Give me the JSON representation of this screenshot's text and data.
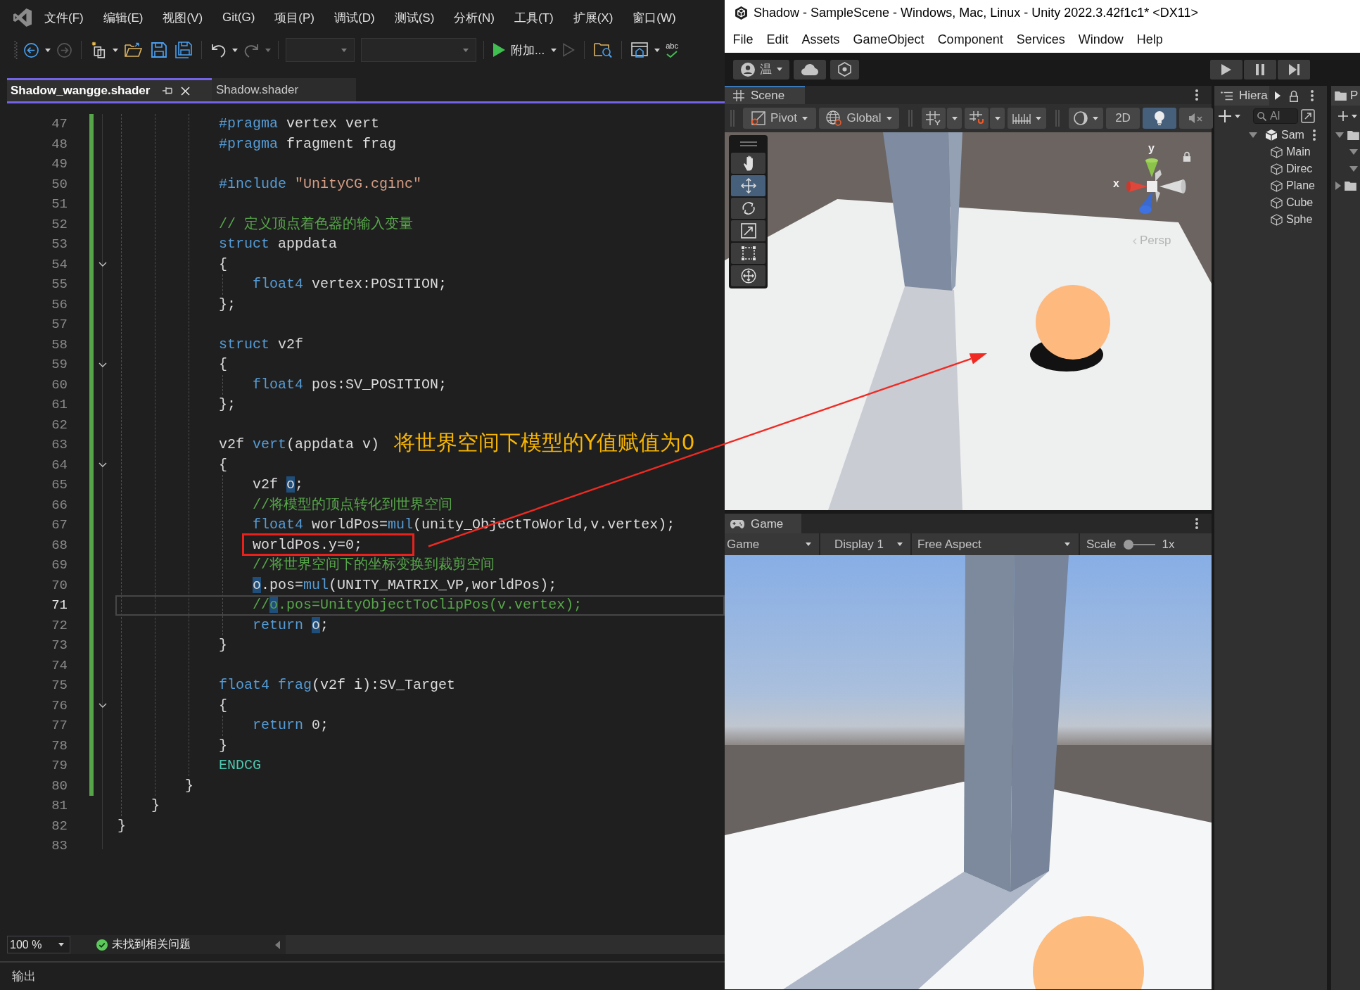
{
  "editor": {
    "menu": [
      "文件(F)",
      "编辑(E)",
      "视图(V)",
      "Git(G)",
      "项目(P)",
      "调试(D)",
      "测试(S)",
      "分析(N)",
      "工具(T)",
      "扩展(X)",
      "窗口(W)"
    ],
    "toolbar": [
      [
        {
          "kind": "back",
          "disabled": false,
          "dropdown": true
        },
        {
          "kind": "forward",
          "disabled": true
        }
      ],
      [
        {
          "kind": "new_project",
          "disabled": false,
          "dropdown": true
        },
        {
          "kind": "open",
          "disabled": false
        },
        {
          "kind": "save",
          "disabled": false
        },
        {
          "kind": "save_all",
          "disabled": false
        }
      ],
      [
        {
          "kind": "undo",
          "disabled": false,
          "dropdown": true
        },
        {
          "kind": "redo",
          "disabled": true,
          "dropdown": true
        }
      ],
      [
        {
          "kind": "config_combo",
          "disabled": true,
          "dropdown": true
        },
        {
          "kind": "platform_combo",
          "disabled": true,
          "dropdown": true
        }
      ],
      [
        {
          "kind": "start",
          "label": "附加...",
          "disabled": false,
          "dropdown": true
        },
        {
          "kind": "start_no_debug",
          "disabled": true
        }
      ],
      [
        {
          "kind": "find_in_files",
          "disabled": false
        }
      ],
      [
        {
          "kind": "layout",
          "disabled": false,
          "dropdown": true
        },
        {
          "kind": "spellcheck",
          "label": "abc",
          "disabled": false
        }
      ]
    ],
    "tabs": [
      {
        "label": "Shadow_wangge.shader",
        "selected": true
      },
      {
        "label": "Shadow.shader",
        "selected": false
      }
    ],
    "lines": [
      {
        "number": "47",
        "changed": true,
        "current": false,
        "tokens": [
          {
            "kind": "keyword",
            "text": "            #pragma"
          },
          {
            "kind": "plain",
            "text": " vertex vert"
          }
        ]
      },
      {
        "number": "48",
        "changed": true,
        "current": false,
        "tokens": [
          {
            "kind": "keyword",
            "text": "            #pragma"
          },
          {
            "kind": "plain",
            "text": " fragment frag"
          }
        ]
      },
      {
        "number": "49",
        "changed": true,
        "current": false
      },
      {
        "number": "50",
        "changed": true,
        "current": false,
        "tokens": [
          {
            "kind": "keyword",
            "text": "            #include"
          },
          {
            "kind": "string",
            "text": " \"UnityCG.cginc\""
          }
        ]
      },
      {
        "number": "51",
        "changed": true,
        "current": false
      },
      {
        "number": "52",
        "changed": true,
        "current": false,
        "tokens": [
          {
            "kind": "comment",
            "text": "            // 定义顶点着色器的输入变量"
          }
        ]
      },
      {
        "number": "53",
        "changed": true,
        "current": false,
        "tokens": [
          {
            "kind": "keyword",
            "text": "            struct"
          },
          {
            "kind": "plain",
            "text": " appdata"
          }
        ]
      },
      {
        "number": "54",
        "changed": true,
        "current": false,
        "fold": true,
        "tokens": [
          {
            "kind": "plain",
            "text": "            {"
          }
        ]
      },
      {
        "number": "55",
        "changed": true,
        "current": false,
        "tokens": [
          {
            "kind": "keyword",
            "text": "                float4"
          },
          {
            "kind": "plain",
            "text": " vertex:POSITION;"
          }
        ]
      },
      {
        "number": "56",
        "changed": true,
        "current": false,
        "tokens": [
          {
            "kind": "plain",
            "text": "            };"
          }
        ]
      },
      {
        "number": "57",
        "changed": true,
        "current": false
      },
      {
        "number": "58",
        "changed": true,
        "current": false,
        "tokens": [
          {
            "kind": "keyword",
            "text": "            struct"
          },
          {
            "kind": "plain",
            "text": " v2f"
          }
        ]
      },
      {
        "number": "59",
        "changed": true,
        "current": false,
        "fold": true,
        "tokens": [
          {
            "kind": "plain",
            "text": "            {"
          }
        ]
      },
      {
        "number": "60",
        "changed": true,
        "current": false,
        "tokens": [
          {
            "kind": "keyword",
            "text": "                float4"
          },
          {
            "kind": "plain",
            "text": " pos:SV_POSITION;"
          }
        ]
      },
      {
        "number": "61",
        "changed": true,
        "current": false,
        "tokens": [
          {
            "kind": "plain",
            "text": "            };"
          }
        ]
      },
      {
        "number": "62",
        "changed": true,
        "current": false
      },
      {
        "number": "63",
        "changed": true,
        "current": false,
        "note": "将世界空间下模型的Y值赋值为0",
        "tokens": [
          {
            "kind": "plain",
            "text": "            v2f "
          },
          {
            "kind": "keyword",
            "text": "vert"
          },
          {
            "kind": "plain",
            "text": "(appdata v)"
          }
        ]
      },
      {
        "number": "64",
        "changed": true,
        "current": false,
        "fold": true,
        "tokens": [
          {
            "kind": "plain",
            "text": "            {"
          }
        ]
      },
      {
        "number": "65",
        "changed": true,
        "current": false,
        "tokens": [
          {
            "kind": "plain",
            "text": "                v2f "
          },
          {
            "kind": "ref",
            "text": "o"
          },
          {
            "kind": "plain",
            "text": ";"
          }
        ]
      },
      {
        "number": "66",
        "changed": true,
        "current": false,
        "tokens": [
          {
            "kind": "comment",
            "text": "                //将模型的顶点转化到世界空间"
          }
        ]
      },
      {
        "number": "67",
        "changed": true,
        "current": false,
        "tokens": [
          {
            "kind": "keyword",
            "text": "                float4"
          },
          {
            "kind": "plain",
            "text": " worldPos="
          },
          {
            "kind": "keyword",
            "text": "mul"
          },
          {
            "kind": "plain",
            "text": "(unity_ObjectToWorld,v.vertex);"
          }
        ]
      },
      {
        "number": "68",
        "changed": true,
        "current": false,
        "boxed": true,
        "tokens": [
          {
            "kind": "plain",
            "text": "                worldPos.y=0;"
          }
        ]
      },
      {
        "number": "69",
        "changed": true,
        "current": false,
        "tokens": [
          {
            "kind": "comment",
            "text": "                //将世界空间下的坐标变换到裁剪空间"
          }
        ]
      },
      {
        "number": "70",
        "changed": true,
        "current": false,
        "tokens": [
          {
            "kind": "ref",
            "text": "                o"
          },
          {
            "kind": "plain",
            "text": ".pos="
          },
          {
            "kind": "keyword",
            "text": "mul"
          },
          {
            "kind": "plain",
            "text": "(UNITY_MATRIX_VP,worldPos);"
          }
        ]
      },
      {
        "number": "71",
        "changed": true,
        "current": true,
        "tokens": [
          {
            "kind": "comment",
            "text": "                //"
          },
          {
            "kind": "comment_ref",
            "text": "o"
          },
          {
            "kind": "comment",
            "text": ".pos=UnityObjectToClipPos(v.vertex);"
          }
        ]
      },
      {
        "number": "72",
        "changed": true,
        "current": false,
        "tokens": [
          {
            "kind": "keyword",
            "text": "                return "
          },
          {
            "kind": "ref",
            "text": "o"
          },
          {
            "kind": "plain",
            "text": ";"
          }
        ]
      },
      {
        "number": "73",
        "changed": true,
        "current": false,
        "tokens": [
          {
            "kind": "plain",
            "text": "            }"
          }
        ]
      },
      {
        "number": "74",
        "changed": true,
        "current": false
      },
      {
        "number": "75",
        "changed": true,
        "current": false,
        "tokens": [
          {
            "kind": "keyword",
            "text": "            float4 frag"
          },
          {
            "kind": "plain",
            "text": "(v2f i):SV_Target"
          }
        ]
      },
      {
        "number": "76",
        "changed": true,
        "current": false,
        "fold": true,
        "tokens": [
          {
            "kind": "plain",
            "text": "            {"
          }
        ]
      },
      {
        "number": "77",
        "changed": true,
        "current": false,
        "tokens": [
          {
            "kind": "keyword",
            "text": "                return"
          },
          {
            "kind": "plain",
            "text": " 0;"
          }
        ]
      },
      {
        "number": "78",
        "changed": true,
        "current": false,
        "tokens": [
          {
            "kind": "plain",
            "text": "            }"
          }
        ]
      },
      {
        "number": "79",
        "changed": true,
        "current": false,
        "tokens": [
          {
            "kind": "macro",
            "text": "            ENDCG"
          }
        ]
      },
      {
        "number": "80",
        "changed": true,
        "current": false,
        "tokens": [
          {
            "kind": "plain",
            "text": "        }"
          }
        ]
      },
      {
        "number": "81",
        "changed": false,
        "current": false,
        "tokens": [
          {
            "kind": "plain",
            "text": "    }"
          }
        ]
      },
      {
        "number": "82",
        "changed": false,
        "current": false,
        "tokens": [
          {
            "kind": "plain",
            "text": "}"
          }
        ]
      },
      {
        "number": "83",
        "changed": false,
        "current": false
      }
    ],
    "status_bar": {
      "zoom": "100 %",
      "issues": "未找到相关问题"
    },
    "output_panel": {
      "title": "输出"
    }
  },
  "unity": {
    "window": {
      "title": "Shadow - SampleScene - Windows, Mac, Linux - Unity 2022.3.42f1c1* <DX11>"
    },
    "menu": [
      "File",
      "Edit",
      "Assets",
      "GameObject",
      "Component",
      "Services",
      "Window",
      "Help"
    ],
    "toolbar": {
      "account": "温",
      "playback": [
        {
          "kind": "play",
          "selected": false
        },
        {
          "kind": "pause",
          "selected": false
        },
        {
          "kind": "step",
          "selected": false
        }
      ]
    },
    "scene": {
      "tab": "Scene",
      "focused": true,
      "pivot": "Pivot",
      "space": "Global",
      "toggles": [
        {
          "kind": "dimension",
          "label": "2D",
          "selected": false
        },
        {
          "kind": "lighting",
          "selected": true
        },
        {
          "kind": "audio",
          "selected": false
        }
      ],
      "tools": [
        {
          "kind": "hand",
          "selected": false
        },
        {
          "kind": "move",
          "selected": true
        },
        {
          "kind": "rotate",
          "selected": false
        },
        {
          "kind": "scale",
          "selected": false
        },
        {
          "kind": "rect",
          "selected": false
        },
        {
          "kind": "transform",
          "selected": false
        }
      ],
      "gizmo": {
        "y_label": "y",
        "x_label": "x",
        "projection": "Persp"
      }
    },
    "game": {
      "tab": "Game",
      "focused": false,
      "view": "Game",
      "display": "Display 1",
      "aspect": "Free Aspect",
      "scale_label": "Scale",
      "scale": {
        "level": 0
      },
      "scale_value": "1x"
    },
    "hierarchy": {
      "tab": "Hiera",
      "search": {
        "placeholder": "Al"
      },
      "items": [
        {
          "label": "Sam",
          "kind": "scene",
          "expanded": true,
          "children": [
            {
              "label": "Main",
              "kind": "object"
            },
            {
              "label": "Direc",
              "kind": "object"
            },
            {
              "label": "Plane",
              "kind": "object"
            },
            {
              "label": "Cube",
              "kind": "object"
            },
            {
              "label": "Sphe",
              "kind": "object"
            }
          ]
        }
      ]
    },
    "project": {
      "tab": "P",
      "folders": [
        {
          "expanded": true,
          "children": [
            {
              "expanded": true
            },
            {
              "expanded": true
            }
          ]
        },
        {
          "expanded": false
        }
      ]
    }
  }
}
